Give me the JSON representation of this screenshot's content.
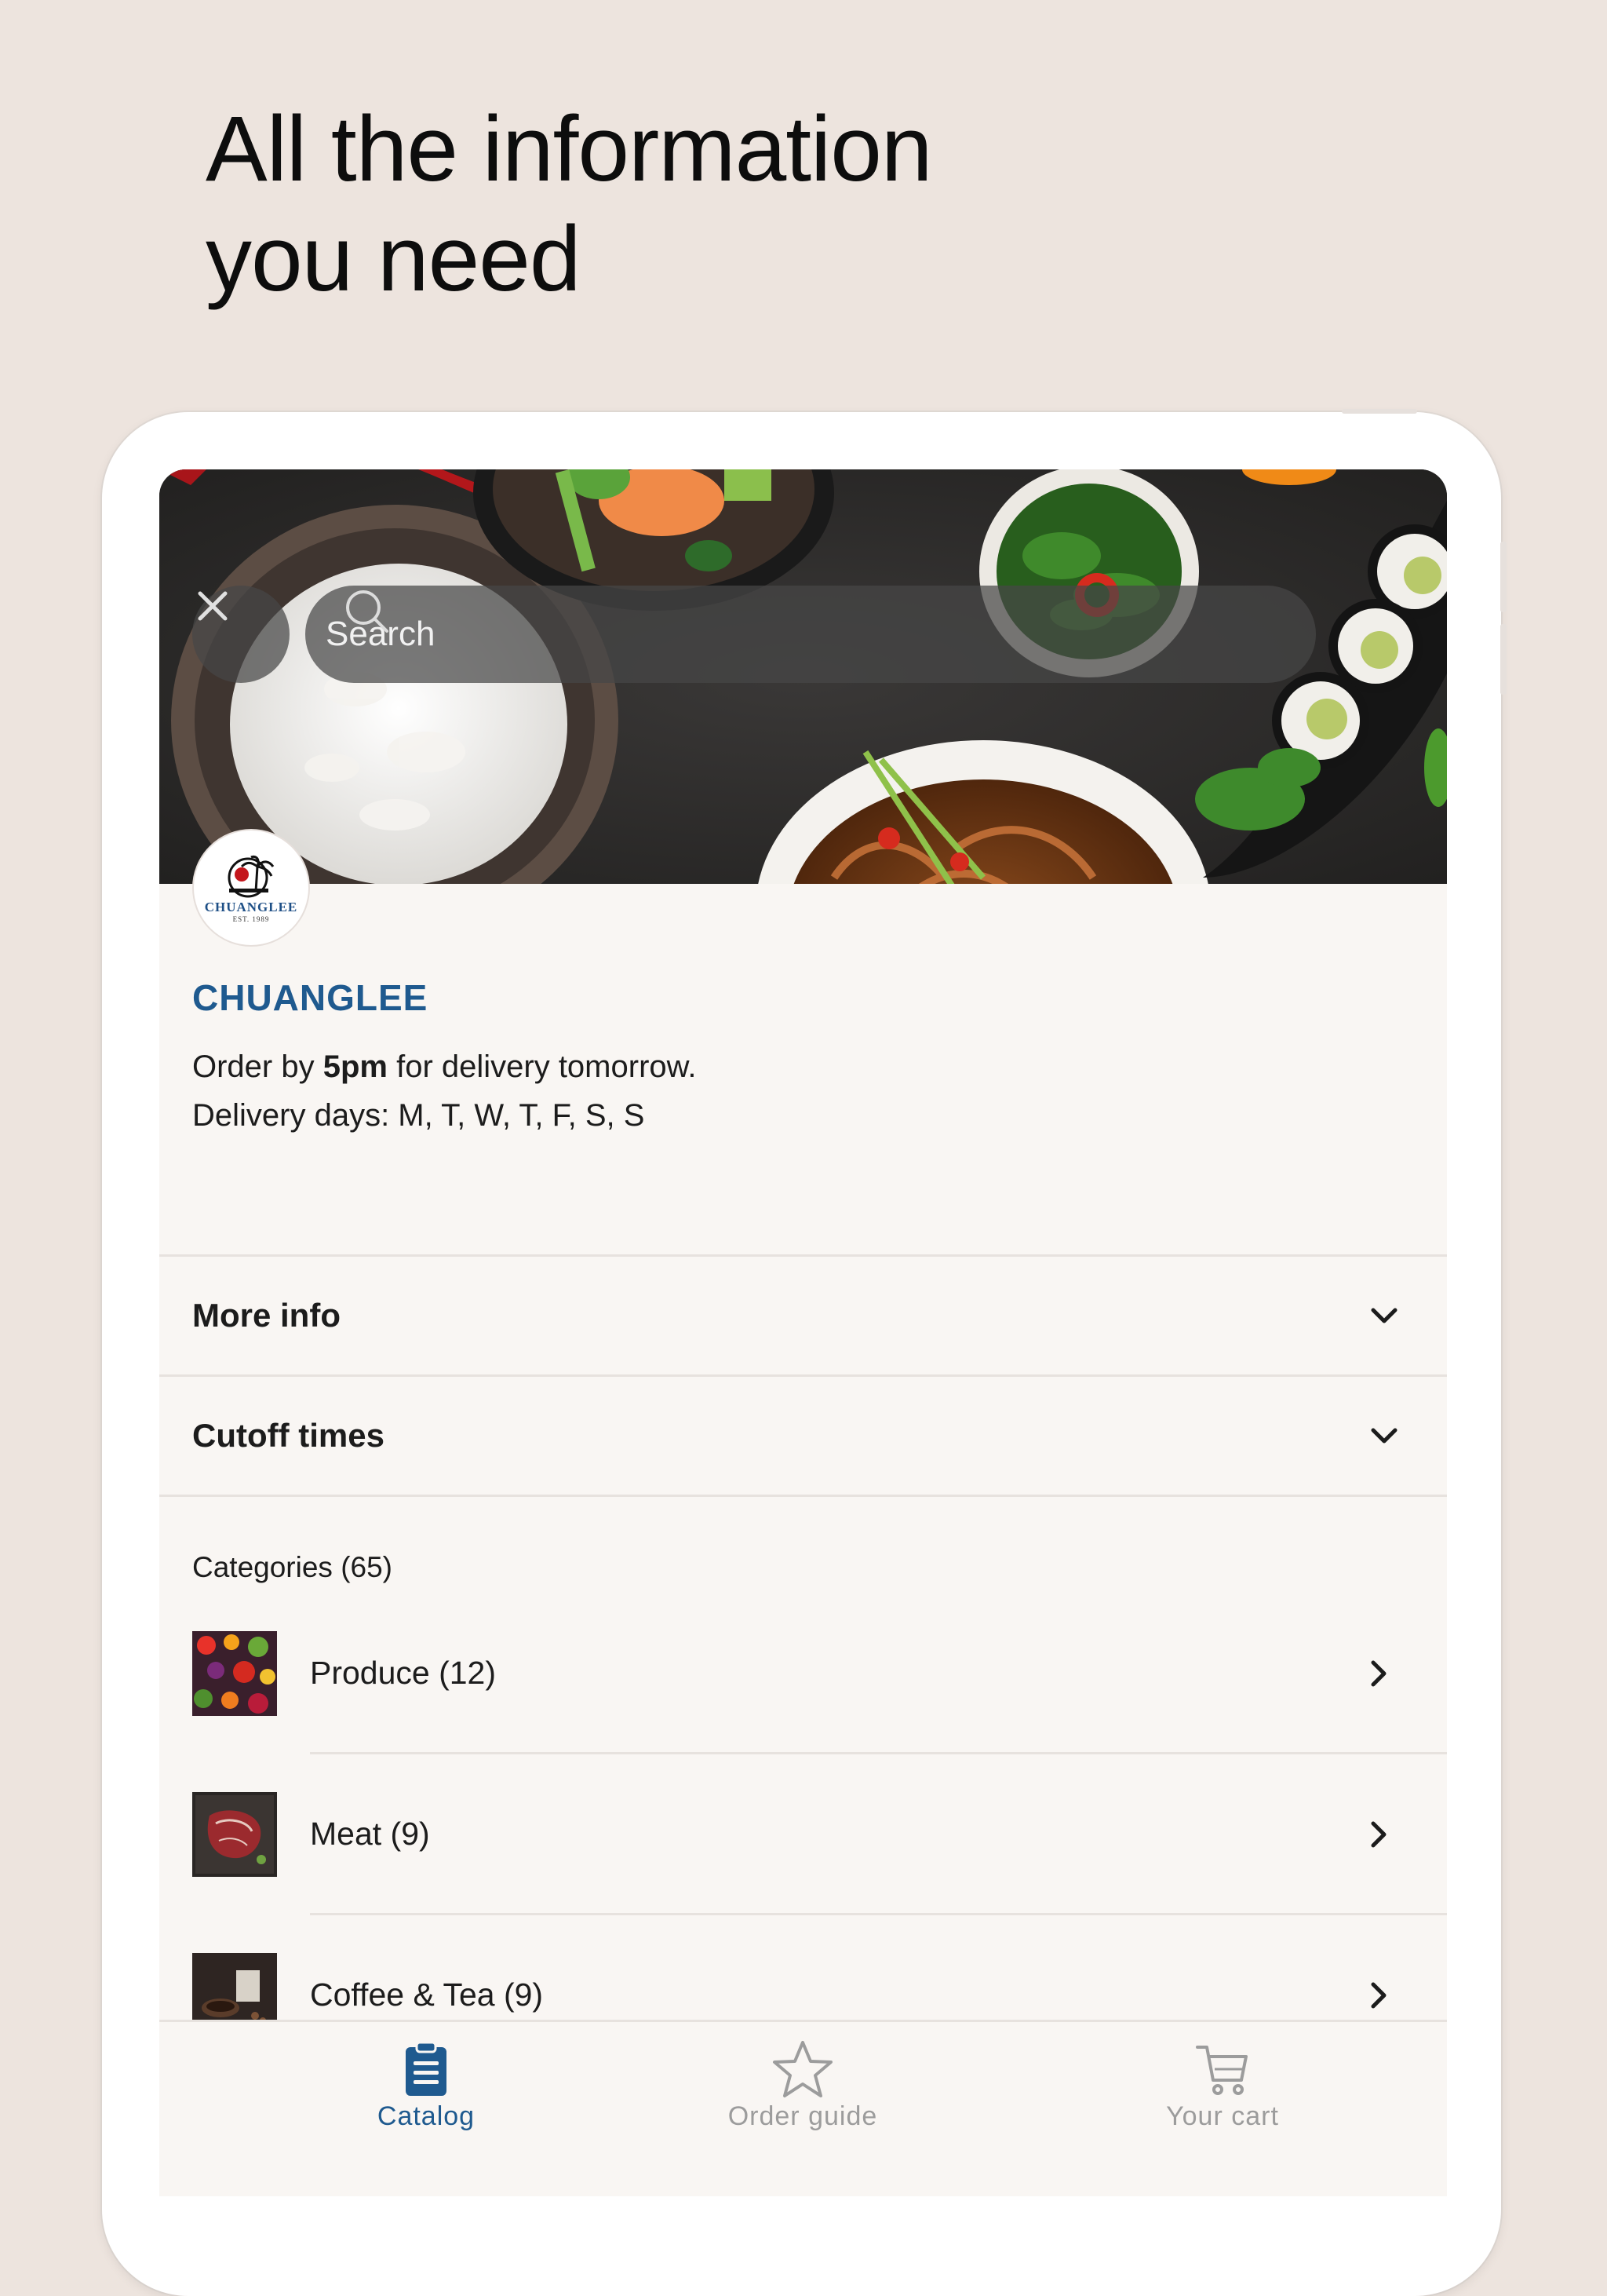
{
  "promo": {
    "headline_line1": "All the information",
    "headline_line2": "you need"
  },
  "search": {
    "placeholder": "Search",
    "icon": "search-icon",
    "close_icon": "close-icon"
  },
  "store": {
    "logo_text": "CHUANGLEE",
    "logo_est": "EST. 1989",
    "name": "CHUANGLEE",
    "order_prefix": "Order by ",
    "order_time": "5pm",
    "order_suffix": " for delivery tomorrow.",
    "delivery_days": "Delivery days: M, T, W, T, F, S, S"
  },
  "sections": [
    {
      "title": "More info",
      "icon": "chevron-down-icon"
    },
    {
      "title": "Cutoff times",
      "icon": "chevron-down-icon"
    }
  ],
  "categories": {
    "header": "Categories (65)",
    "items": [
      {
        "label": "Produce (12)",
        "icon": "chevron-right-icon"
      },
      {
        "label": "Meat (9)",
        "icon": "chevron-right-icon"
      },
      {
        "label": "Coffee & Tea (9)",
        "icon": "chevron-right-icon"
      }
    ]
  },
  "tabbar": {
    "tabs": [
      {
        "label": "Catalog",
        "icon": "clipboard-icon",
        "active": true
      },
      {
        "label": "Order guide",
        "icon": "star-icon",
        "active": false
      },
      {
        "label": "Your cart",
        "icon": "cart-icon",
        "active": false
      }
    ]
  },
  "colors": {
    "background": "#ede4de",
    "brand": "#1f5a8f",
    "screen": "#f9f6f3",
    "inactive_tab": "#9c9c9c"
  }
}
